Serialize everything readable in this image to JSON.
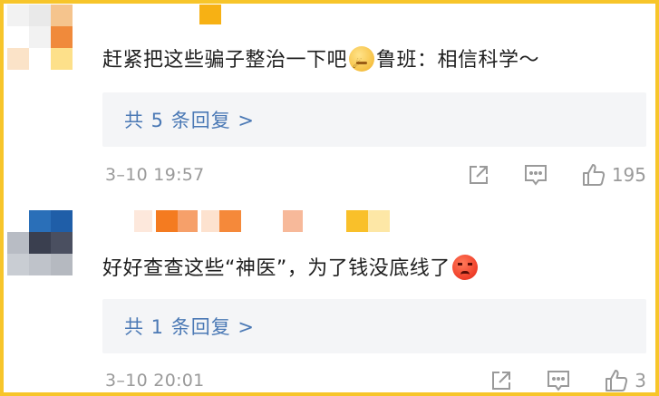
{
  "comments": [
    {
      "text_before_emoji": "赶紧把这些骗子整治一下吧",
      "emoji": "dizzy-face-emoji",
      "text_after_emoji": "鲁班：相信科学～",
      "reply_link": "共 5 条回复 >",
      "time": "3–10 19:57",
      "like_count": "195"
    },
    {
      "text_before_emoji": "好好查查这些“神医”，为了钱没底线了",
      "emoji": "angry-face-emoji",
      "text_after_emoji": "",
      "reply_link": "共 1 条回复 >",
      "time": "3–10 20:01",
      "like_count": "3"
    }
  ],
  "colors": {
    "frame": "#f7c52a",
    "link": "#4b79b5",
    "meta": "#9a9a9a",
    "reply_bg": "#f4f5f7"
  }
}
